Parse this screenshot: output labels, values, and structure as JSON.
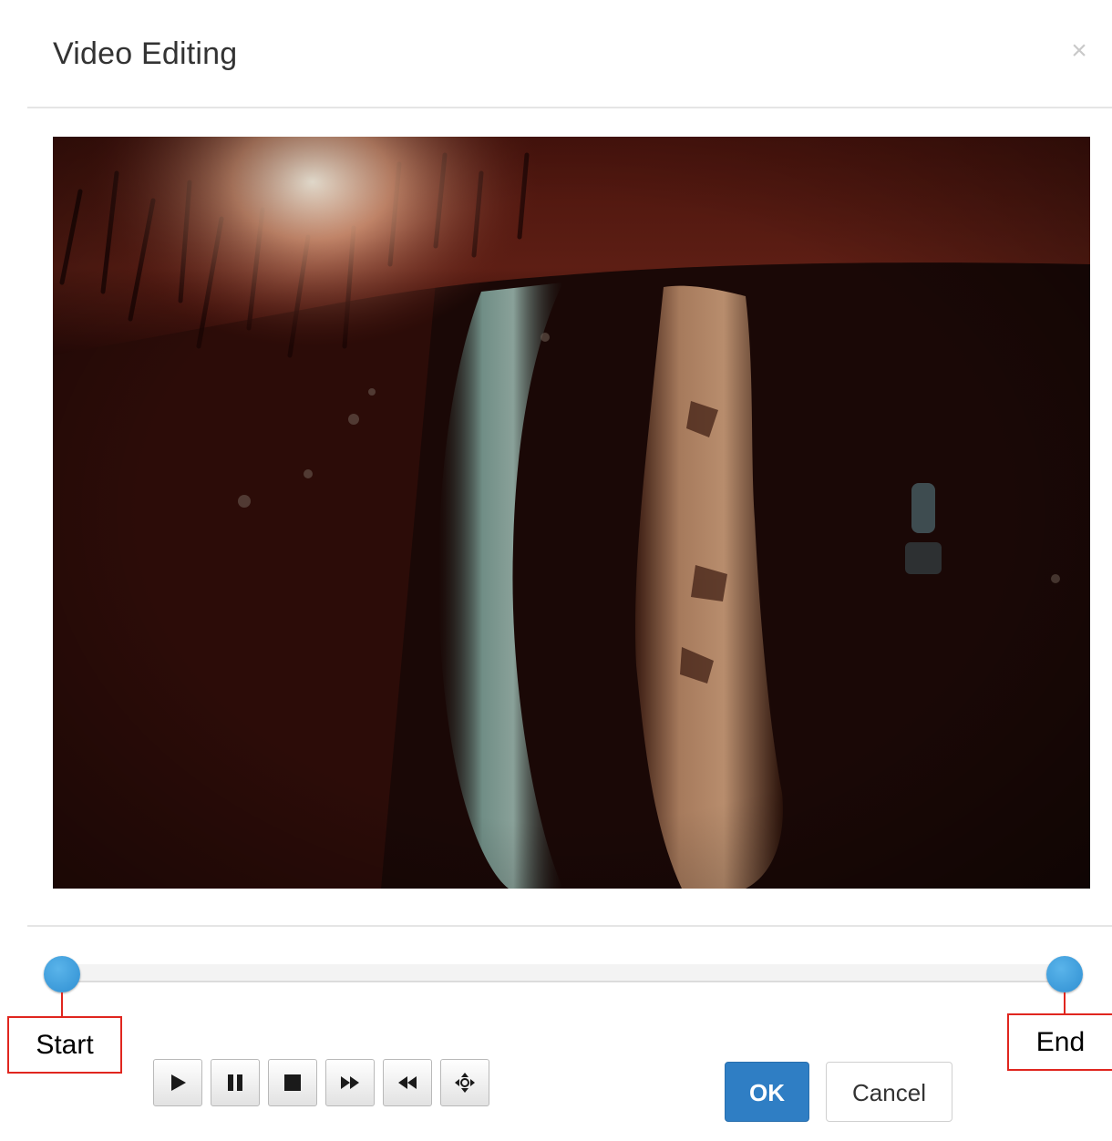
{
  "dialog": {
    "title": "Video Editing",
    "close_glyph": "×"
  },
  "video": {
    "description_icon": "slit-lamp-eye-video-frame"
  },
  "trim_slider": {
    "start_fraction": 0.0,
    "end_fraction": 1.0,
    "start_label": "Start",
    "end_label": "End",
    "thumb_color": "#3a9de0",
    "annotation_color": "#e0261f"
  },
  "playback_controls": [
    {
      "name": "play-icon"
    },
    {
      "name": "pause-icon"
    },
    {
      "name": "stop-icon"
    },
    {
      "name": "fast-forward-icon"
    },
    {
      "name": "rewind-icon"
    },
    {
      "name": "move-crosshair-icon"
    }
  ],
  "buttons": {
    "ok_label": "OK",
    "ok_color": "#2f7ec4",
    "cancel_label": "Cancel"
  }
}
